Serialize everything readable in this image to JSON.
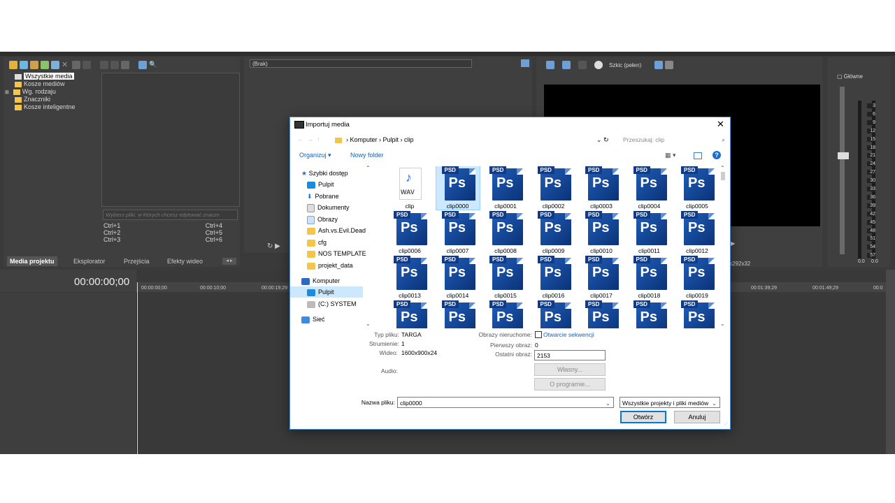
{
  "app": {
    "tree": [
      "Wszystkie media",
      "Kosze mediów",
      "Wg. rodzaju",
      "Znaczniki",
      "Kosze inteligentne"
    ],
    "search_placeholder": "Wybierz pliki, w których chcesz edytować znaczn",
    "shortcuts": [
      [
        "Ctrl+1",
        "Ctrl+4"
      ],
      [
        "Ctrl+2",
        "Ctrl+5"
      ],
      [
        "Ctrl+3",
        "Ctrl+6"
      ]
    ],
    "tabs": [
      "Media projektu",
      "Eksplorator",
      "Przejścia",
      "Efekty wideo"
    ],
    "trimmer_select": "(Brak)",
    "preview_quality": "Szkic (pełen)",
    "preview_res": "x292x32",
    "master_label": "Główne",
    "meter_scale": [
      "3",
      "6",
      "9",
      "12",
      "15",
      "18",
      "21",
      "24",
      "27",
      "30",
      "33",
      "36",
      "39",
      "42",
      "45",
      "48",
      "51",
      "54",
      "57"
    ],
    "meter_values": [
      "0.0",
      "0.0"
    ],
    "timecode": "00:00:00;00",
    "ruler_left": [
      "00:00:00;00",
      "00:00:10;00",
      "00:00:19;29"
    ],
    "ruler_right": [
      "00:01:39;29",
      "00:01:49;29",
      "00:0"
    ]
  },
  "dialog": {
    "title": "Importuj media",
    "breadcrumb": [
      "Komputer",
      "Pulpit",
      "clip"
    ],
    "search_placeholder": "Przeszukaj: clip",
    "organize": "Organizuj",
    "new_folder": "Nowy folder",
    "nav": {
      "quick_access": "Szybki dostęp",
      "quick_items": [
        "Pulpit",
        "Pobrane",
        "Dokumenty",
        "Obrazy",
        "Ash.vs.Evil.Dead",
        "cfg",
        "NOS TEMPLATE",
        "projekt_data"
      ],
      "computer": "Komputer",
      "computer_items": [
        "Pulpit",
        "(C:) SYSTEM"
      ],
      "network": "Sieć"
    },
    "files": [
      "clip",
      "clip0000",
      "clip0001",
      "clip0002",
      "clip0003",
      "clip0004",
      "clip0005",
      "clip0006",
      "clip0007",
      "clip0008",
      "clip0009",
      "clip0010",
      "clip0011",
      "clip0012",
      "clip0013",
      "clip0014",
      "clip0015",
      "clip0016",
      "clip0017",
      "clip0018",
      "clip0019",
      "",
      "",
      "",
      "",
      "",
      "",
      ""
    ],
    "wav_tag": "WAV",
    "psd_tag": "PSD",
    "ps_text": "Ps",
    "info": {
      "file_type_label": "Typ pliku:",
      "file_type": "TARGA",
      "streams_label": "Strumienie:",
      "streams": "1",
      "video_label": "Wideo:",
      "video": "1600x900x24",
      "audio_label": "Audio:",
      "still_label": "Obrazy nieruchome:",
      "sequence_open": "Otwarcie sekwencji",
      "first_label": "Pierwszy obraz:",
      "first": "0",
      "last_label": "Ostatni obraz:",
      "last": "2153",
      "custom_btn": "Własny...",
      "about_btn": "O programie..."
    },
    "filename_label": "Nazwa pliku:",
    "filename": "clip0000",
    "filter": "Wszystkie projekty i pliki mediów",
    "open_btn": "Otwórz",
    "cancel_btn": "Anuluj"
  }
}
